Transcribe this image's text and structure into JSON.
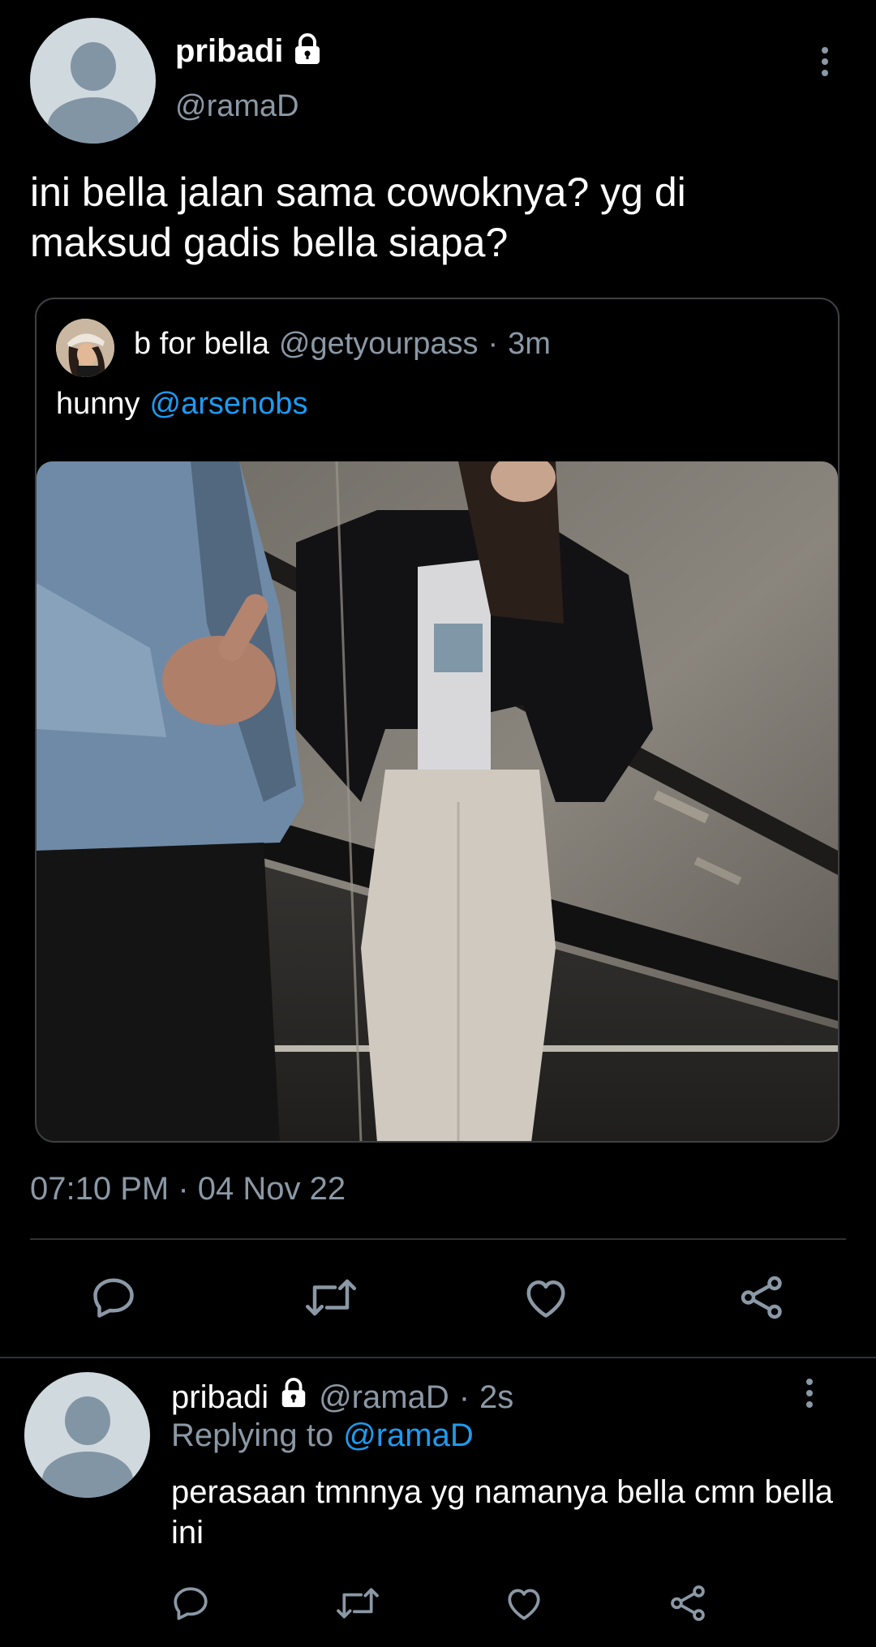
{
  "main_tweet": {
    "display_name": "pribadi",
    "handle": "@ramaD",
    "text": "ini bella jalan sama cowoknya? yg di maksud gadis bella siapa?",
    "timestamp": "07:10 PM · 04 Nov 22",
    "icons": [
      "lock-icon",
      "more-icon",
      "reply-icon",
      "retweet-icon",
      "like-icon",
      "share-icon"
    ]
  },
  "quoted_tweet": {
    "display_name": "b for bella",
    "handle": "@getyourpass",
    "separator": "·",
    "time": "3m",
    "text_prefix": "hunny",
    "mention": "@arsenobs"
  },
  "reply": {
    "display_name": "pribadi",
    "handle": "@ramaD",
    "separator": "·",
    "time": "2s",
    "replying_to_label": "Replying to",
    "replying_to_handle": "@ramaD",
    "text": "perasaan tmnnya yg namanya bella cmn bella ini"
  },
  "colors": {
    "background": "#000000",
    "text": "#ffffff",
    "secondary": "#8b98a5",
    "link": "#1d9bf0",
    "divider": "#2f3336"
  }
}
